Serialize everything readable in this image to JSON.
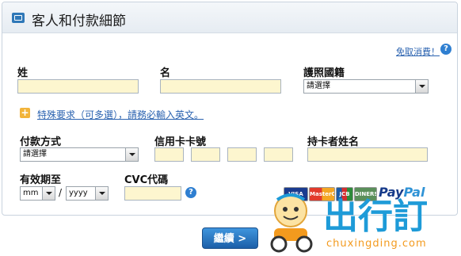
{
  "header": {
    "title": "客人和付款細節",
    "icon": "card-icon"
  },
  "faq": {
    "label": "免取消費！"
  },
  "guest": {
    "surname_label": "姓",
    "given_name_label": "名",
    "nationality_label": "護照國籍",
    "nationality_value": "請選擇"
  },
  "special_request": {
    "label": "特殊要求（可多選），請務必輸入英文。"
  },
  "payment": {
    "method_label": "付款方式",
    "method_value": "請選擇",
    "card_number_label": "信用卡卡號",
    "cardholder_label": "持卡者姓名",
    "expiry_label": "有效期至",
    "month_value": "mm",
    "separator": "/",
    "year_value": "yyyy",
    "cvc_label": "CVC代碼"
  },
  "card_logos": [
    "VISA",
    "MasterCard",
    "JCB",
    "DINERS",
    "PayPal"
  ],
  "button": {
    "continue_label": "繼續 >"
  },
  "watermark": {
    "logo_text": "出行訂",
    "url": "chuxingding.com"
  },
  "colors": {
    "accent": "#2f7fd1",
    "field_bg": "#fdf6cf",
    "watermark_orange": "#f39a1e",
    "watermark_blue": "#1e9bd8"
  }
}
